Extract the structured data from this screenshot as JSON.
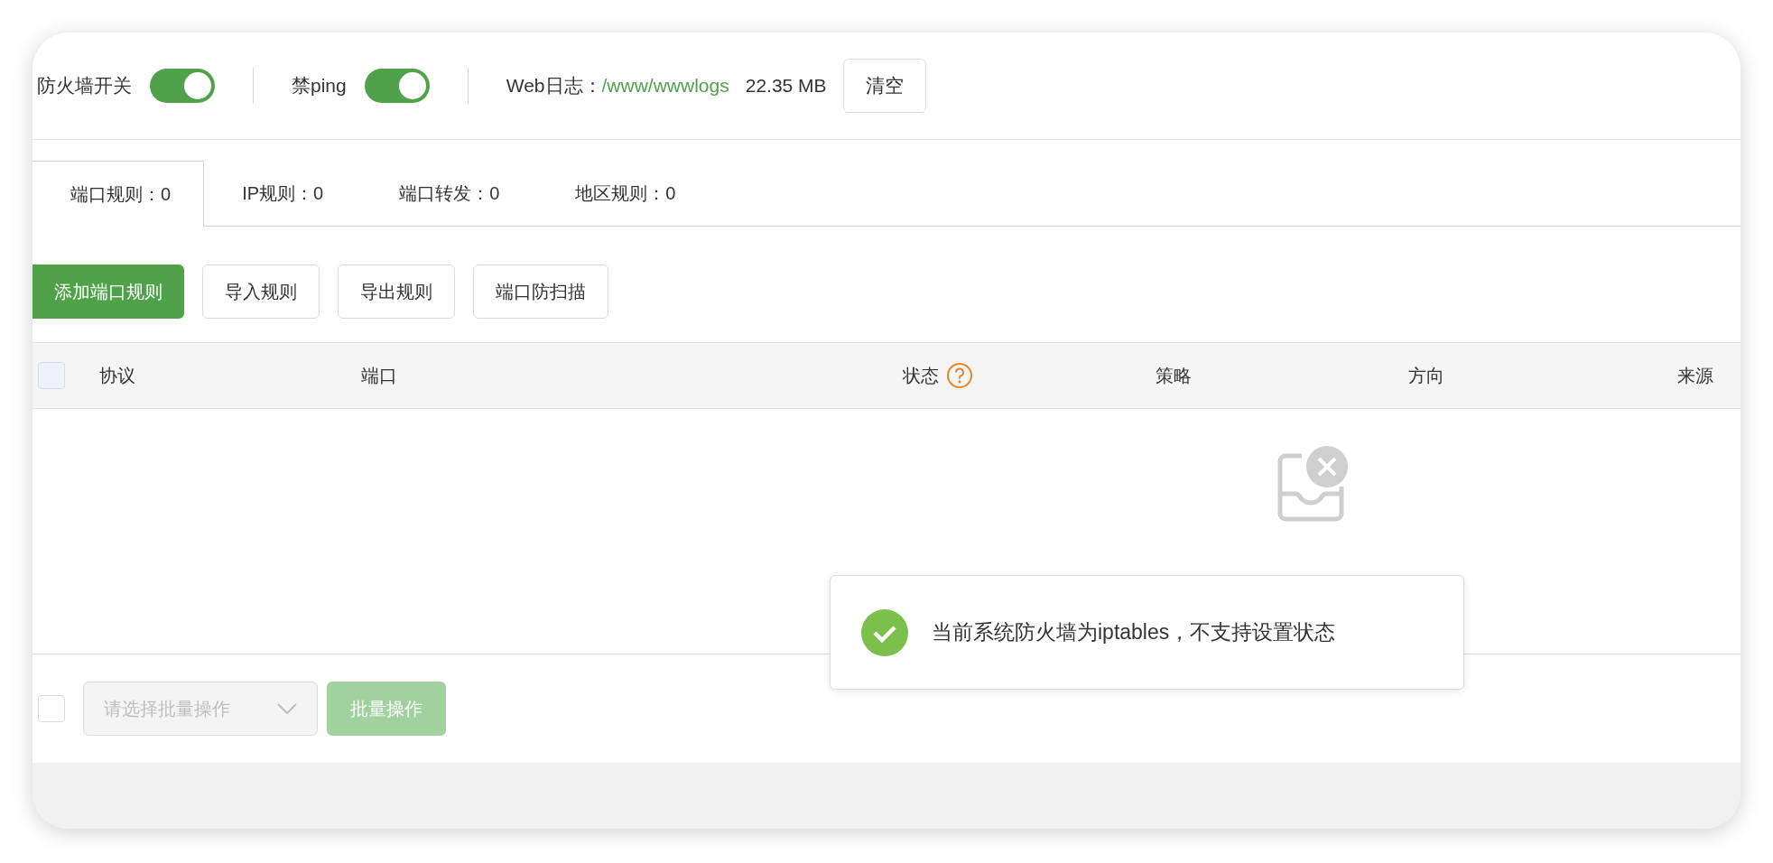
{
  "toolbar": {
    "switches": [
      {
        "label": "防火墙开关",
        "on": true
      },
      {
        "label": "禁ping",
        "on": true
      }
    ],
    "web_log": {
      "label": "Web日志：",
      "path": "/www/wwwlogs",
      "size": "22.35 MB",
      "clear_button": "清空"
    }
  },
  "tabs": [
    {
      "label": "端口规则：0",
      "selected": true
    },
    {
      "label": "IP规则：0",
      "selected": false
    },
    {
      "label": "端口转发：0",
      "selected": false
    },
    {
      "label": "地区规则：0",
      "selected": false
    }
  ],
  "actions": [
    {
      "label": "添加端口规则",
      "kind": "primary"
    },
    {
      "label": "导入规则",
      "kind": "default"
    },
    {
      "label": "导出规则",
      "kind": "default"
    },
    {
      "label": "端口防扫描",
      "kind": "default"
    }
  ],
  "table": {
    "select_all": {
      "checked": false
    },
    "columns": [
      {
        "label": "协议"
      },
      {
        "label": "端口"
      },
      {
        "label": "状态",
        "help": true
      },
      {
        "label": "策略"
      },
      {
        "label": "方向"
      },
      {
        "label": "来源"
      }
    ]
  },
  "footer": {
    "select_all": {
      "checked": false
    },
    "batch_select": {
      "placeholder": "请选择批量操作",
      "disabled": true
    },
    "batch_button": {
      "label": "批量操作",
      "disabled": true
    }
  },
  "toast": {
    "kind": "success",
    "message": "当前系统防火墙为iptables，不支持设置状态"
  }
}
